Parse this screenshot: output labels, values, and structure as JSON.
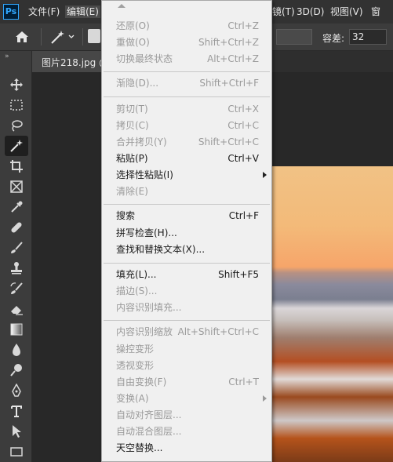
{
  "menubar": {
    "logo": "Ps",
    "file": "文件(F)",
    "edit": "编辑(E)",
    "layer_partial": "(L)",
    "type_partial": "字(Y)",
    "select_partial": "(S)",
    "filter_partial": "镜(T)",
    "3d": "3D(D)",
    "view": "视图(V)",
    "window": "窗"
  },
  "options": {
    "tolerance_label": "容差:",
    "tolerance_value": "32"
  },
  "document": {
    "tab_title": "图片218.jpg @"
  },
  "edit_menu": {
    "items": [
      {
        "label": "还原(O)",
        "shortcut": "Ctrl+Z",
        "enabled": false
      },
      {
        "label": "重做(O)",
        "shortcut": "Shift+Ctrl+Z",
        "enabled": false
      },
      {
        "label": "切换最终状态",
        "shortcut": "Alt+Ctrl+Z",
        "enabled": false
      },
      {
        "label": "渐隐(D)...",
        "shortcut": "Shift+Ctrl+F",
        "enabled": false
      },
      {
        "label": "剪切(T)",
        "shortcut": "Ctrl+X",
        "enabled": false
      },
      {
        "label": "拷贝(C)",
        "shortcut": "Ctrl+C",
        "enabled": false
      },
      {
        "label": "合并拷贝(Y)",
        "shortcut": "Shift+Ctrl+C",
        "enabled": false
      },
      {
        "label": "粘贴(P)",
        "shortcut": "Ctrl+V",
        "enabled": true
      },
      {
        "label": "选择性粘贴(I)",
        "shortcut": "",
        "enabled": true,
        "submenu": true
      },
      {
        "label": "清除(E)",
        "shortcut": "",
        "enabled": false
      },
      {
        "label": "搜索",
        "shortcut": "Ctrl+F",
        "enabled": true
      },
      {
        "label": "拼写检查(H)...",
        "shortcut": "",
        "enabled": true
      },
      {
        "label": "查找和替换文本(X)...",
        "shortcut": "",
        "enabled": true
      },
      {
        "label": "填充(L)...",
        "shortcut": "Shift+F5",
        "enabled": true
      },
      {
        "label": "描边(S)...",
        "shortcut": "",
        "enabled": false
      },
      {
        "label": "内容识别填充...",
        "shortcut": "",
        "enabled": false
      },
      {
        "label": "内容识别缩放",
        "shortcut": "Alt+Shift+Ctrl+C",
        "enabled": false
      },
      {
        "label": "操控变形",
        "shortcut": "",
        "enabled": false
      },
      {
        "label": "透视变形",
        "shortcut": "",
        "enabled": false
      },
      {
        "label": "自由变换(F)",
        "shortcut": "Ctrl+T",
        "enabled": false
      },
      {
        "label": "变换(A)",
        "shortcut": "",
        "enabled": false,
        "submenu": true
      },
      {
        "label": "自动对齐图层...",
        "shortcut": "",
        "enabled": false
      },
      {
        "label": "自动混合图层...",
        "shortcut": "",
        "enabled": false
      },
      {
        "label": "天空替换...",
        "shortcut": "",
        "enabled": true
      }
    ]
  },
  "tools": [
    "move-tool",
    "marquee-tool",
    "lasso-tool",
    "magic-wand-tool",
    "crop-tool",
    "frame-tool",
    "eyedropper-tool",
    "healing-brush-tool",
    "brush-tool",
    "clone-stamp-tool",
    "history-brush-tool",
    "eraser-tool",
    "gradient-tool",
    "blur-tool",
    "dodge-tool",
    "pen-tool",
    "type-tool",
    "path-selection-tool",
    "rectangle-tool"
  ]
}
